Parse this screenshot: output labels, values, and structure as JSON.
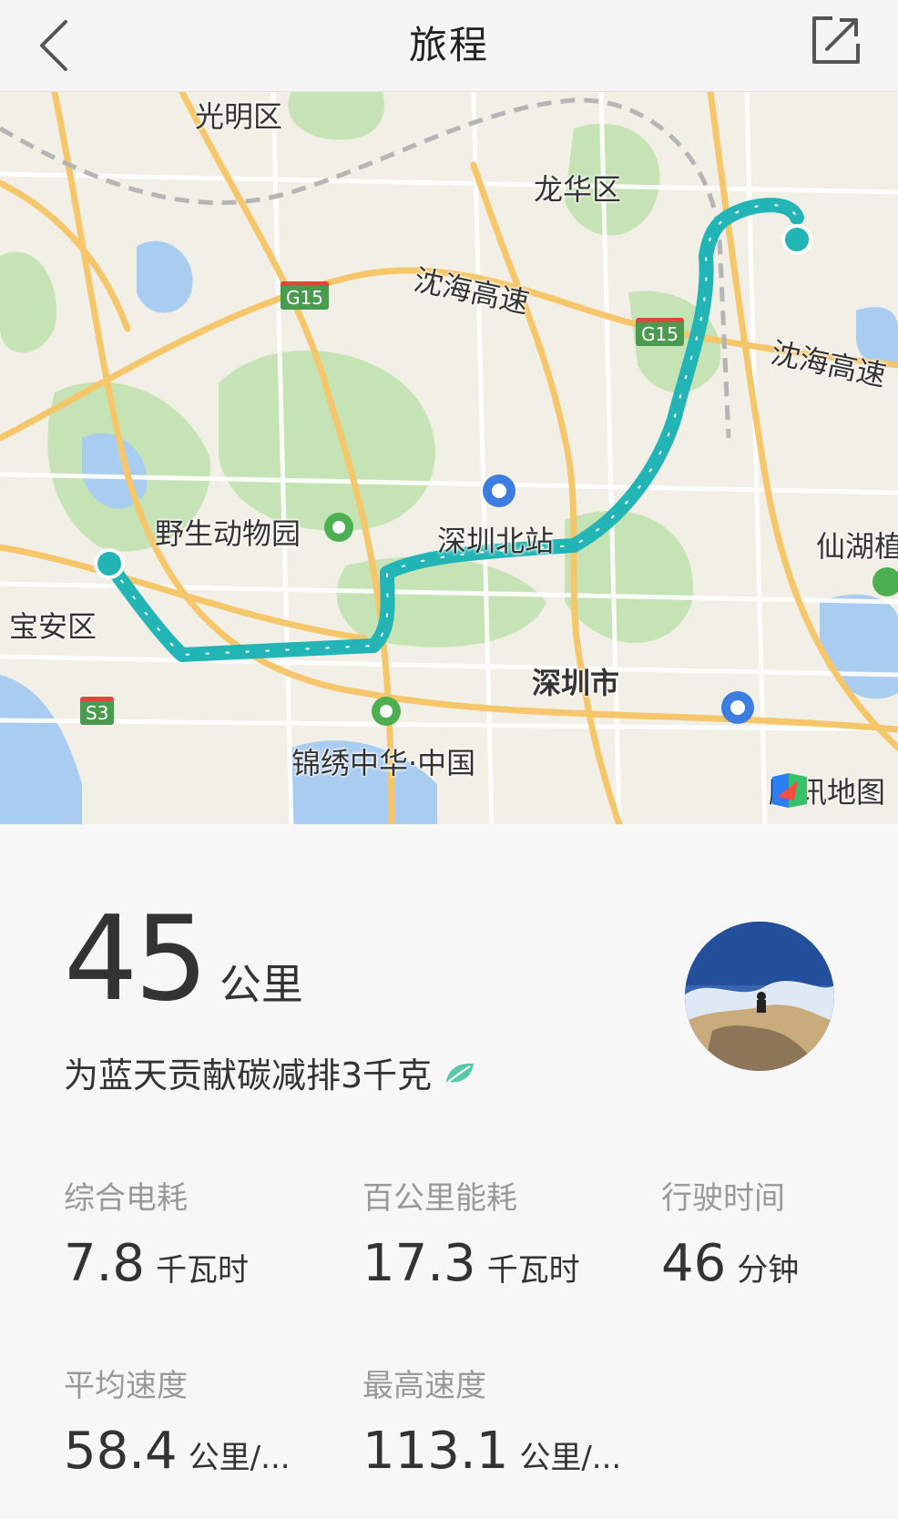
{
  "header": {
    "title": "旅程"
  },
  "map": {
    "labels": {
      "guangming": "光明区",
      "longhua": "龙华区",
      "shenhai1": "沈海高速",
      "shenhai2": "沈海高速",
      "zoo": "野生动物园",
      "north_station": "深圳北站",
      "baoan": "宝安区",
      "shenzhen": "深圳市",
      "xianhu": "仙湖植",
      "splendid": "锦绣中华·中国",
      "g15a": "G15",
      "g15b": "G15",
      "s3": "S3"
    },
    "attribution": "腾讯地图",
    "route_color": "#23b5b5"
  },
  "trip": {
    "distance_value": "45",
    "distance_unit": "公里",
    "carbon_text": "为蓝天贡献碳减排3千克"
  },
  "stats": [
    {
      "label": "综合电耗",
      "value": "7.8",
      "unit": "千瓦时"
    },
    {
      "label": "百公里能耗",
      "value": "17.3",
      "unit": "千瓦时"
    },
    {
      "label": "行驶时间",
      "value": "46",
      "unit": "分钟"
    },
    {
      "label": "平均速度",
      "value": "58.4",
      "unit": "公里/..."
    },
    {
      "label": "最高速度",
      "value": "113.1",
      "unit": "公里/..."
    }
  ]
}
